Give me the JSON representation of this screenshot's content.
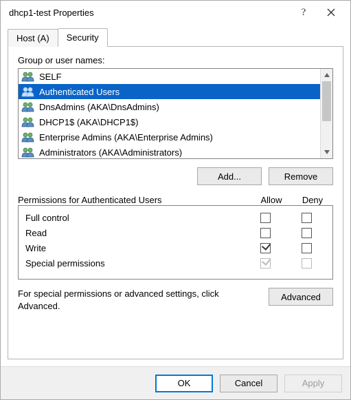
{
  "titlebar": {
    "title": "dhcp1-test Properties"
  },
  "tabs": {
    "host": "Host (A)",
    "security": "Security"
  },
  "group_label": "Group or user names:",
  "groups": [
    {
      "name": "SELF"
    },
    {
      "name": "Authenticated Users"
    },
    {
      "name": "DnsAdmins (AKA\\DnsAdmins)"
    },
    {
      "name": "DHCP1$ (AKA\\DHCP1$)"
    },
    {
      "name": "Enterprise Admins (AKA\\Enterprise Admins)"
    },
    {
      "name": "Administrators (AKA\\Administrators)"
    }
  ],
  "selected_group_index": 1,
  "buttons": {
    "add": "Add...",
    "remove": "Remove",
    "advanced": "Advanced",
    "ok": "OK",
    "cancel": "Cancel",
    "apply": "Apply"
  },
  "perm_header": {
    "label": "Permissions for Authenticated Users",
    "allow": "Allow",
    "deny": "Deny"
  },
  "permissions": [
    {
      "name": "Full control",
      "allow": false,
      "deny": false,
      "disabled": false
    },
    {
      "name": "Read",
      "allow": false,
      "deny": false,
      "disabled": false
    },
    {
      "name": "Write",
      "allow": true,
      "deny": false,
      "disabled": false
    },
    {
      "name": "Special permissions",
      "allow": true,
      "deny": false,
      "disabled": true
    }
  ],
  "advanced_text": "For special permissions or advanced settings, click Advanced."
}
